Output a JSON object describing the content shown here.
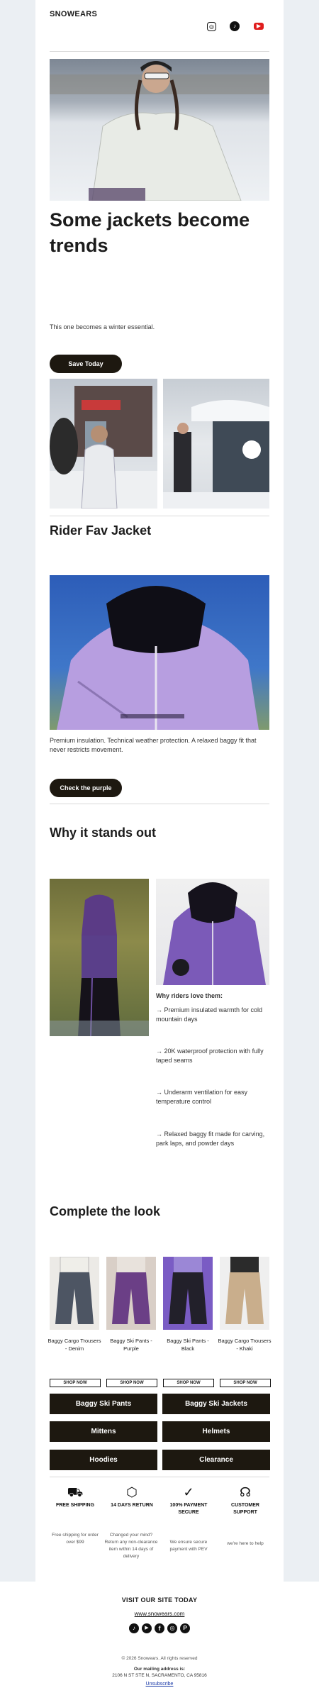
{
  "brand": {
    "name": "SNOWEARS"
  },
  "social_header": [
    {
      "icon": "instagram-icon",
      "glyph": "◎"
    },
    {
      "icon": "tiktok-icon",
      "glyph": "♪"
    },
    {
      "icon": "youtube-icon",
      "glyph": "▶"
    }
  ],
  "hero": {
    "title": "Some jackets become trends",
    "subtitle": "This one becomes a winter essential.",
    "cta": "Save Today"
  },
  "feature": {
    "title": "Rider Fav Jacket",
    "description": "Premium insulation. Technical weather protection. A relaxed baggy fit that never restricts movement.",
    "cta": "Check the purple"
  },
  "why": {
    "title": "Why it stands out",
    "list_title": "Why riders love them:",
    "bullets": [
      "→ Premium insulated warmth for cold mountain days",
      "→ 20K waterproof protection with fully taped seams",
      "→ Underarm ventilation for easy temperature control",
      "→ Relaxed baggy fit made for carving, park laps, and powder days"
    ]
  },
  "look": {
    "title": "Complete the look",
    "products": [
      {
        "name": "Baggy Cargo Trousers - Denim",
        "cta": "SHOP NOW",
        "color": "#4d5563"
      },
      {
        "name": "Baggy Ski Pants - Purple",
        "cta": "SHOP NOW",
        "color": "#6b3f86"
      },
      {
        "name": "Baggy Ski Pants - Black",
        "cta": "SHOP NOW",
        "color": "#22202a"
      },
      {
        "name": "Baggy Cargo Trousers - Khaki",
        "cta": "SHOP NOW",
        "color": "#c9ae8c"
      }
    ]
  },
  "categories": [
    "Baggy Ski Pants",
    "Baggy Ski Jackets",
    "Mittens",
    "Helmets",
    "Hoodies",
    "Clearance"
  ],
  "features": [
    {
      "icon": "truck-icon",
      "glyph": "⛟",
      "title": "FREE SHIPPING",
      "sub": "Free shipping for order over $99"
    },
    {
      "icon": "box-icon",
      "glyph": "⬡",
      "title": "14 DAYS RETURN",
      "sub": "Changed your mind? Return any non-clearance item within 14 days of delivery"
    },
    {
      "icon": "check-circle-icon",
      "glyph": "✓",
      "title": "100% PAYMENT SECURE",
      "sub": "We ensure secure payment with PEV"
    },
    {
      "icon": "headset-icon",
      "glyph": "☊",
      "title": "CUSTOMER SUPPORT",
      "sub": "we're here to help"
    }
  ],
  "footer": {
    "visit": "VISIT OUR SITE TODAY",
    "url": "www.snowears.com",
    "social": [
      {
        "icon": "tiktok-icon",
        "glyph": "♪"
      },
      {
        "icon": "youtube-icon",
        "glyph": "▶"
      },
      {
        "icon": "facebook-icon",
        "glyph": "f"
      },
      {
        "icon": "instagram-icon",
        "glyph": "◎"
      },
      {
        "icon": "pinterest-icon",
        "glyph": "P"
      }
    ],
    "copyright": "© 2026 Snowears. All rights reserved",
    "mailing_label": "Our mailing address is:",
    "address": "2106 N ST STE N, SACRAMENTO, CA 95816",
    "unsubscribe": "Unsubscribe"
  },
  "colors": {
    "button": "#1d1810",
    "background": "#ebeff3",
    "accent_purple": "#a98fd8"
  }
}
